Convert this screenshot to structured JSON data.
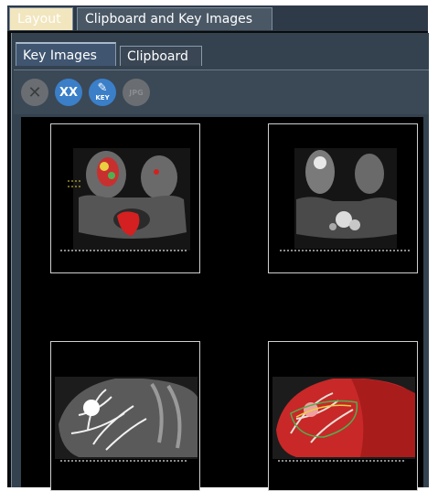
{
  "tabs_top": {
    "layout": "Layout",
    "clipboard_and_key_images": "Clipboard and Key Images"
  },
  "tabs_sub": {
    "key_images": "Key Images",
    "clipboard": "Clipboard"
  },
  "toolbar": {
    "delete_icon": "close-icon",
    "delete_all_label": "XX",
    "key_label": "KEY",
    "jpg_label": "JPG"
  },
  "thumbnails": [
    {
      "name": "breast-mri-axial-color-overlay",
      "overlay_color": "#d42020"
    },
    {
      "name": "breast-mri-axial-grayscale"
    },
    {
      "name": "breast-mri-sagittal-mip-grayscale"
    },
    {
      "name": "breast-mri-sagittal-color-overlay",
      "overlay_color": "#d42020"
    }
  ],
  "colors": {
    "frame_bg": "#34424f",
    "viewer_bg": "#000000",
    "button_active": "#3a7fc8",
    "button_disabled": "#6a6e72"
  }
}
